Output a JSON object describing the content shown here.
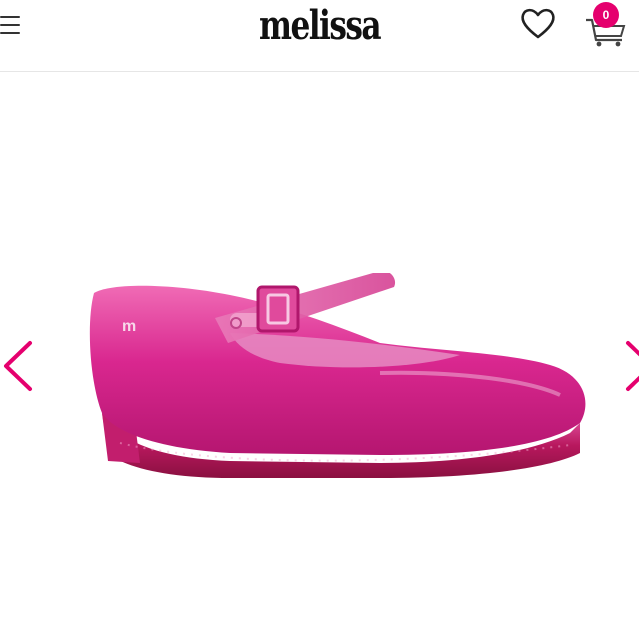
{
  "header": {
    "logo_text": "melissa",
    "menu_icon": "hamburger-menu-icon",
    "wishlist_icon": "heart-icon",
    "cart_icon": "cart-icon",
    "cart_count": "0"
  },
  "colors": {
    "brand_pink": "#e5006e",
    "shoe_pink": "#d9278f",
    "text": "#111111",
    "divider": "#e6e6e6"
  },
  "gallery": {
    "image": "pink-mary-jane-shoe",
    "prev_icon": "chevron-left-icon",
    "next_icon": "chevron-right-icon"
  }
}
